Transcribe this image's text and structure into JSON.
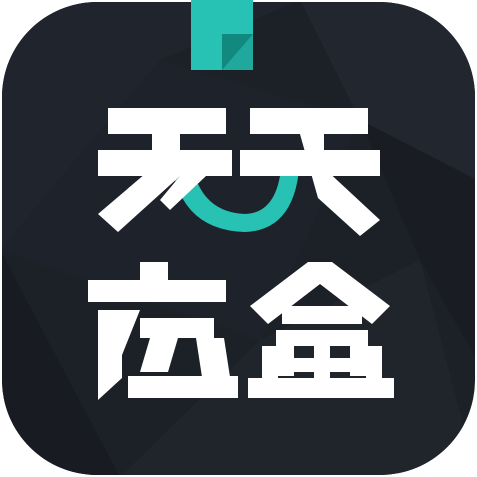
{
  "app_icon": {
    "name_line_1": "天天",
    "name_line_2": "壳盒"
  },
  "colors": {
    "background": "#1c2027",
    "facet_light": "#262b33",
    "facet_dark": "#171a20",
    "accent": "#27c2b3",
    "accent_dark": "#11897e",
    "text": "#ffffff"
  }
}
